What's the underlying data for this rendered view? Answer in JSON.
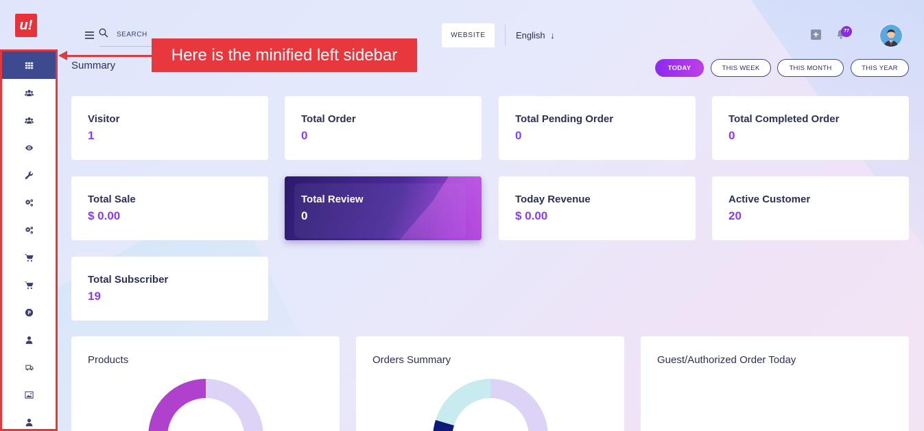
{
  "sidebar": {
    "logo_text": "u!",
    "items": [
      {
        "icon": "dashboard-grid-icon",
        "active": true
      },
      {
        "icon": "users-icon"
      },
      {
        "icon": "users-group-icon"
      },
      {
        "icon": "eye-icon"
      },
      {
        "icon": "wrench-icon"
      },
      {
        "icon": "gears-icon"
      },
      {
        "icon": "gears-alt-icon"
      },
      {
        "icon": "cart-icon"
      },
      {
        "icon": "cart-alt-icon"
      },
      {
        "icon": "product-p-icon"
      },
      {
        "icon": "user-icon"
      },
      {
        "icon": "delivery-truck-icon"
      },
      {
        "icon": "image-icon"
      },
      {
        "icon": "user-alt-icon"
      }
    ]
  },
  "topbar": {
    "search_placeholder": "SEARCH",
    "website_label": "WEBSITE",
    "language": "English",
    "notification_count": "77"
  },
  "callout": {
    "text": "Here is the minified left sidebar",
    "color": "#e8383d"
  },
  "summary": {
    "title": "Summary",
    "filters": [
      {
        "label": "TODAY",
        "active": true
      },
      {
        "label": "THIS WEEK"
      },
      {
        "label": "THIS MONTH"
      },
      {
        "label": "THIS YEAR"
      }
    ]
  },
  "cards": [
    {
      "label": "Visitor",
      "value": "1"
    },
    {
      "label": "Total Order",
      "value": "0"
    },
    {
      "label": "Total Pending Order",
      "value": "0"
    },
    {
      "label": "Total Completed Order",
      "value": "0"
    },
    {
      "label": "Total Sale",
      "value": "$ 0.00"
    },
    {
      "label": "Total Review",
      "value": "0"
    },
    {
      "label": "Today Revenue",
      "value": "$ 0.00"
    },
    {
      "label": "Active Customer",
      "value": "20"
    },
    {
      "label": "Total Subscriber",
      "value": "19"
    }
  ],
  "panels": [
    {
      "title": "Products"
    },
    {
      "title": "Orders Summary"
    },
    {
      "title": "Guest/Authorized Order Today"
    }
  ],
  "colors": {
    "accent": "#8a3ded",
    "sidebar_active": "#3e4a8f",
    "highlight_border": "#e03a3e"
  }
}
